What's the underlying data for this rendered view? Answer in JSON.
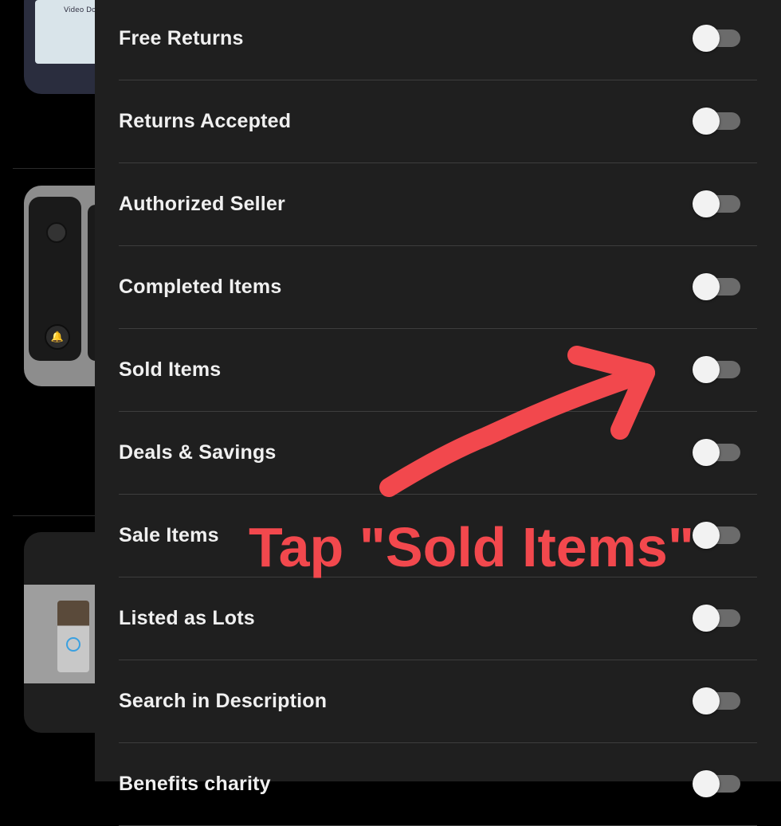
{
  "filters": {
    "items": [
      {
        "label": "Free Returns",
        "on": false
      },
      {
        "label": "Returns Accepted",
        "on": false
      },
      {
        "label": "Authorized Seller",
        "on": false
      },
      {
        "label": "Completed Items",
        "on": false
      },
      {
        "label": "Sold Items",
        "on": false
      },
      {
        "label": "Deals & Savings",
        "on": false
      },
      {
        "label": "Sale Items",
        "on": false
      },
      {
        "label": "Listed as Lots",
        "on": false
      },
      {
        "label": "Search in Description",
        "on": false
      },
      {
        "label": "Benefits charity",
        "on": false
      }
    ]
  },
  "background": {
    "card1_box_text": "Video Door"
  },
  "annotation": {
    "text": "Tap \"Sold Items\"",
    "color": "#f2484d",
    "arrow_icon": "red-arrow-icon"
  },
  "colors": {
    "panel": "#1f1f1f",
    "divider": "#3d3d3d",
    "toggle_track": "#6b6b6b",
    "toggle_knob": "#f2f2f2"
  }
}
